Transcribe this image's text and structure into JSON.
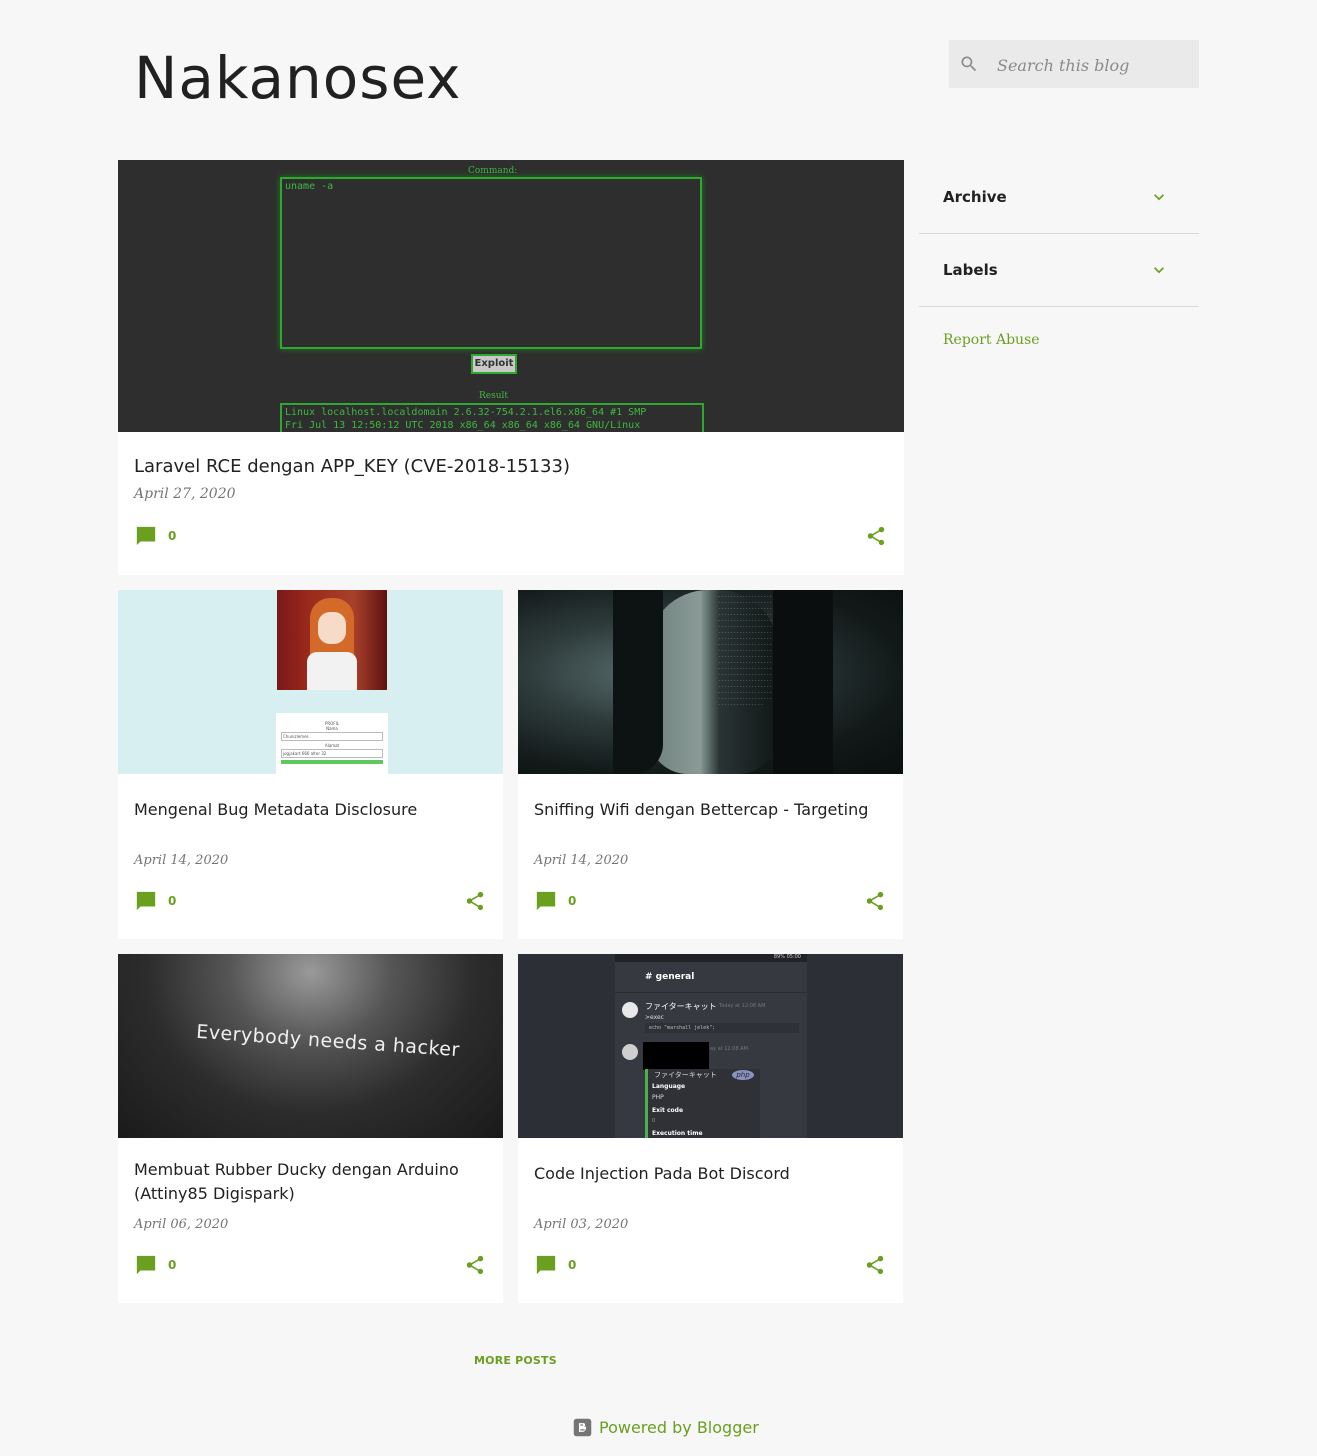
{
  "header": {
    "blog_title": "Nakanosex",
    "search_placeholder": "Search this blog"
  },
  "colors": {
    "accent": "#6a9f1f",
    "background": "#f7f7f7",
    "card": "#ffffff",
    "title": "#212121"
  },
  "posts": [
    {
      "title": "Laravel RCE dengan APP_KEY (CVE-2018-15133)",
      "date": "April 27, 2020",
      "comments": "0",
      "thumb": {
        "command_label": "Command:",
        "command_value": "uname -a",
        "button_label": "Exploit",
        "result_label": "Result",
        "result_line1": "Linux localhost.localdomain 2.6.32-754.2.1.el6.x86_64 #1 SMP",
        "result_line2": "Fri Jul 13 12:50:12 UTC 2018 x86_64 x86_64 x86_64 GNU/Linux"
      }
    },
    {
      "title": "Mengenal Bug Metadata Disclosure",
      "date": "April 14, 2020",
      "comments": "0",
      "thumb": {
        "profil": "PROFIL",
        "nama": "Nama",
        "nama_value": "Chunizlemes",
        "alamat": "Alamat",
        "alamat_value": "jogjakart 666 alter 32"
      }
    },
    {
      "title": "Sniffing Wifi dengan Bettercap - Targeting",
      "date": "April 14, 2020",
      "comments": "0"
    },
    {
      "title": "Membuat Rubber Ducky dengan Arduino (Attiny85 Digispark)",
      "date": "April 06, 2020",
      "comments": "0",
      "thumb": {
        "shirt_text": "Everybody needs a hacker"
      }
    },
    {
      "title": "Code Injection Pada Bot Discord",
      "date": "April 03, 2020",
      "comments": "0",
      "thumb": {
        "channel": "# general",
        "user": "ファイターキャット",
        "time1": "Today at 12:08 AM",
        "cmd": ">exec",
        "code": "echo \"marshall jelek\";",
        "time2": "ay at 12:08 AM",
        "bot": "ファイターキャット",
        "badge": "php",
        "lang_label": "Language",
        "lang_value": "PHP",
        "exit_label": "Exit code",
        "exit_value": "0",
        "exec_label": "Execution time",
        "status": "89% 05:00"
      }
    }
  ],
  "sidebar": {
    "archive": "Archive",
    "labels": "Labels",
    "report_abuse": "Report Abuse"
  },
  "footer": {
    "more_posts": "MORE POSTS",
    "powered_by": "Powered by Blogger"
  }
}
